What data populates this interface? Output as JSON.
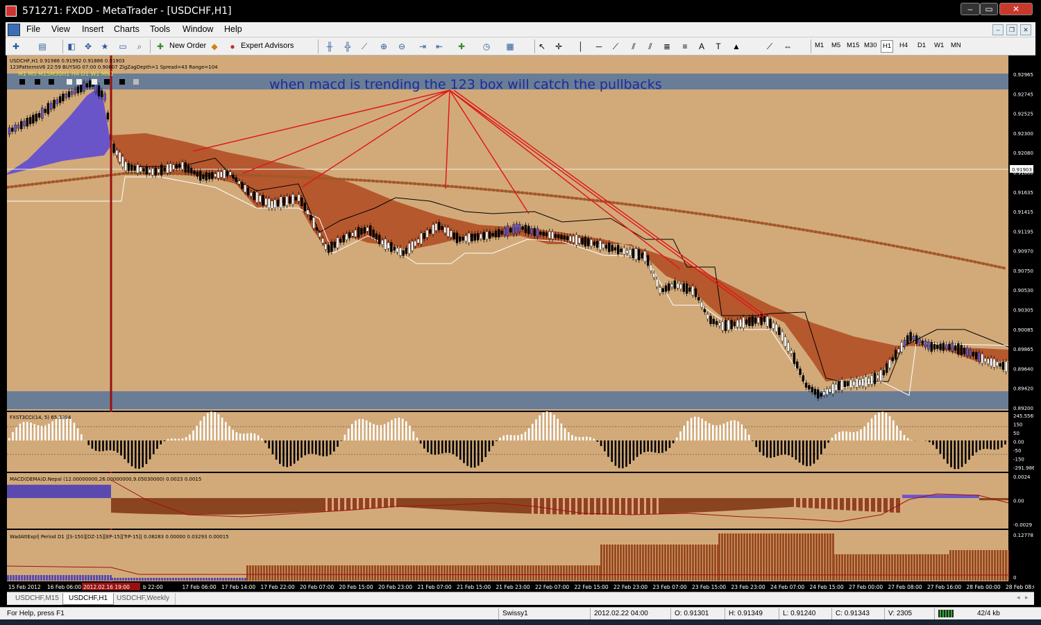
{
  "window": {
    "title": "571271: FXDD - MetaTrader - [USDCHF,H1]"
  },
  "menu": [
    "File",
    "View",
    "Insert",
    "Charts",
    "Tools",
    "Window",
    "Help"
  ],
  "toolbar": {
    "new_order": "New Order",
    "expert_advisors": "Expert Advisors",
    "timeframes": [
      "M1",
      "M5",
      "M15",
      "M30",
      "H1",
      "H4",
      "D1",
      "W1",
      "MN"
    ],
    "active_timeframe": "H1"
  },
  "chart": {
    "info_line1": "USDCHF,H1  0.91986 0.91992 0.91886 0.91903",
    "info_line2": "123PatternsV6  22:59  BUYSIG  07:00  0.90807  ZigZagDepth=1  Spread=43  Range=104",
    "tf_labels": "M1  M5  M15M30H1  H4  D1  W1  MN1",
    "annotation": "when macd is trending the 123 box will catch the pullbacks",
    "current_price": "0.91903",
    "price_axis": [
      "0.92965",
      "0.92745",
      "0.92525",
      "0.92300",
      "0.92080",
      "0.91860",
      "0.91635",
      "0.91415",
      "0.91195",
      "0.90970",
      "0.90750",
      "0.90530",
      "0.90305",
      "0.90085",
      "0.89865",
      "0.89640",
      "0.89420",
      "0.89200"
    ],
    "cci_label": "FXST3CCI(14, 5) 65.3394",
    "cci_axis": [
      "245.5565",
      "150",
      "50",
      "0.00",
      "-50",
      "-150",
      "-291.986"
    ],
    "macd_label": "MACD(DEMA)D.Nepal (12.00000000,26.00000000,9.05030000) 0.0023 0.0015",
    "macd_axis": [
      "0.0024",
      "0.00",
      "-0.0029"
    ],
    "wad_label": "WadAttExpl| Period D1 |[S-150][DZ-15][EP-15][TrP-15]| 0.08283 0.00000 0.03293 0.00015",
    "wad_axis": [
      "0.12778",
      "0"
    ],
    "time_axis": [
      "15 Feb 2012",
      "16 Feb 06:00",
      "2012.02.16 19:00",
      "b 22:00",
      "17 Feb 06:00",
      "17 Feb 14:00",
      "17 Feb 22:00",
      "20 Feb 07:00",
      "20 Feb 15:00",
      "20 Feb 23:00",
      "21 Feb 07:00",
      "21 Feb 15:00",
      "21 Feb 23:00",
      "22 Feb 07:00",
      "22 Feb 15:00",
      "22 Feb 23:00",
      "23 Feb 07:00",
      "23 Feb 15:00",
      "23 Feb 23:00",
      "24 Feb 07:00",
      "24 Feb 15:00",
      "27 Feb 00:00",
      "27 Feb 08:00",
      "27 Feb 16:00",
      "28 Feb 00:00",
      "28 Feb 08:00"
    ],
    "colors": {
      "background": "#d2aa7a",
      "band": "#6a7d96",
      "cloud": "#b6582d",
      "dots": "#a3572a",
      "bull_cloud": "#6a55c8",
      "annotation": "#1a2c9a",
      "lines": "#e01818"
    }
  },
  "tabs": [
    "USDCHF,M15",
    "USDCHF,H1",
    "USDCHF,Weekly"
  ],
  "active_tab": "USDCHF,H1",
  "status": {
    "help": "For Help, press F1",
    "profile": "Swissy1",
    "time": "2012.02.22 04:00",
    "open": "O: 0.91301",
    "high": "H: 0.91349",
    "low": "L: 0.91240",
    "close": "C: 0.91343",
    "volume": "V: 2305",
    "traffic": "42/4 kb"
  }
}
